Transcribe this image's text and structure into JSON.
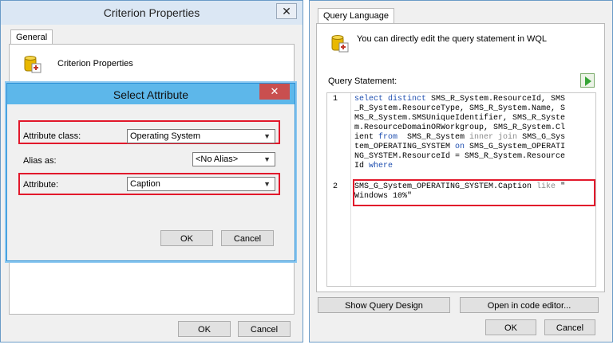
{
  "criterion_window": {
    "title": "Criterion Properties",
    "close": "✕",
    "tab": "General",
    "header_label": "Criterion Properties",
    "ok": "OK",
    "cancel": "Cancel"
  },
  "select_attribute": {
    "title": "Select Attribute",
    "close": "✕",
    "attribute_class_label": "Attribute class:",
    "attribute_class_value": "Operating System",
    "alias_label": "Alias as:",
    "alias_value": "<No Alias>",
    "attribute_label": "Attribute:",
    "attribute_value": "Caption",
    "ok": "OK",
    "cancel": "Cancel"
  },
  "query_window": {
    "tab": "Query Language",
    "info": "You can directly edit the query statement in WQL",
    "statement_label": "Query Statement:",
    "line_numbers": [
      "1",
      "2"
    ],
    "code_line1": [
      [
        {
          "t": "select distinct ",
          "c": "kw"
        },
        {
          "t": "SMS_R_System.ResourceId, SMS"
        }
      ],
      [
        {
          "t": "_R_System.ResourceType, SMS_R_System.Name, S"
        }
      ],
      [
        {
          "t": "MS_R_System.SMSUniqueIdentifier, SMS_R_Syste"
        }
      ],
      [
        {
          "t": "m.ResourceDomainORWorkgroup, SMS_R_System.Cl"
        }
      ],
      [
        {
          "t": "ient "
        },
        {
          "t": "from",
          "c": "kw"
        },
        {
          "t": "  SMS_R_System "
        },
        {
          "t": "inner join",
          "c": "gray"
        },
        {
          "t": " SMS_G_Sys"
        }
      ],
      [
        {
          "t": "tem_OPERATING_SYSTEM "
        },
        {
          "t": "on",
          "c": "kw"
        },
        {
          "t": " SMS_G_System_OPERATI"
        }
      ],
      [
        {
          "t": "NG_SYSTEM.ResourceId = SMS_R_System.Resource"
        }
      ],
      [
        {
          "t": "Id "
        },
        {
          "t": "where",
          "c": "kw"
        }
      ]
    ],
    "code_line2": [
      [
        {
          "t": "SMS_G_System_OPERATING_SYSTEM.Caption "
        },
        {
          "t": "like",
          "c": "gray"
        },
        {
          "t": " \""
        }
      ],
      [
        {
          "t": "Windows 10%\""
        }
      ]
    ],
    "show_design": "Show Query Design",
    "open_editor": "Open in code editor...",
    "ok": "OK",
    "cancel": "Cancel"
  }
}
